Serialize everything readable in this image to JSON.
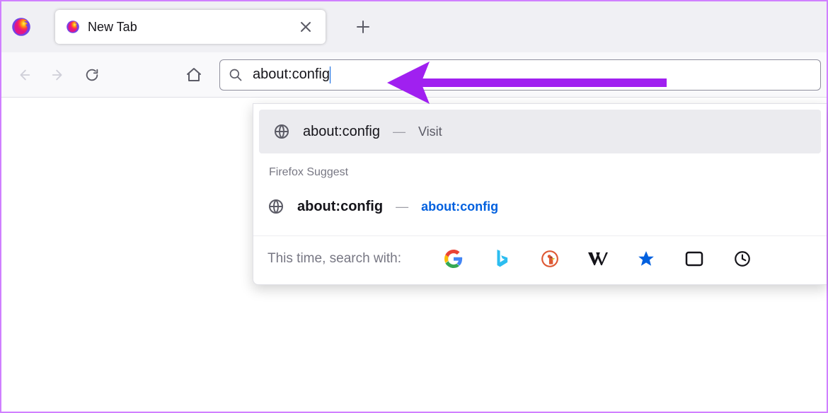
{
  "tab": {
    "title": "New Tab"
  },
  "address": {
    "value": "about:config"
  },
  "dropdown": {
    "row1": {
      "title": "about:config",
      "suffix": "Visit"
    },
    "suggestLabel": "Firefox Suggest",
    "row2": {
      "title": "about:config",
      "link": "about:config"
    },
    "enginesLabel": "This time, search with:"
  },
  "engines": [
    "Google",
    "Bing",
    "DuckDuckGo",
    "Wikipedia",
    "Bookmarks",
    "Tabs",
    "History"
  ],
  "colors": {
    "accent": "#a020f0",
    "link": "#0060df"
  },
  "annotation": {
    "type": "arrow",
    "color": "#a020f0"
  }
}
